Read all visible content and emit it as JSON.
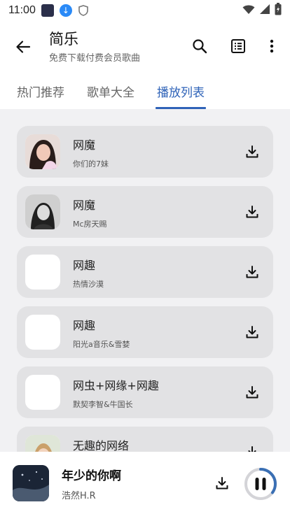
{
  "status": {
    "time": "11:00"
  },
  "appbar": {
    "title": "简乐",
    "subtitle": "免费下载付费会员歌曲"
  },
  "tabs": [
    {
      "label": "热门推荐",
      "active": false
    },
    {
      "label": "歌单大全",
      "active": false
    },
    {
      "label": "播放列表",
      "active": true
    }
  ],
  "songs": [
    {
      "title": "网魔",
      "artist": "你们的7妹",
      "cover": "photo-woman"
    },
    {
      "title": "网魔",
      "artist": "Mc房天赐",
      "cover": "photo-man"
    },
    {
      "title": "网趣",
      "artist": "热情沙漠",
      "cover": "blank"
    },
    {
      "title": "网趣",
      "artist": "阳光a音乐&雪婪",
      "cover": "blank"
    },
    {
      "title": "网虫+网缘+网趣",
      "artist": "默契李智&牛国长",
      "cover": "blank"
    },
    {
      "title": "无趣的网络",
      "artist": "",
      "cover": "photo-boy"
    }
  ],
  "player": {
    "title": "年少的你啊",
    "artist": "浩然H.R",
    "progress": 0.35
  },
  "colors": {
    "accent": "#2f63b8",
    "list_bg": "#f1f1f3",
    "card_bg": "#e2e2e4"
  }
}
